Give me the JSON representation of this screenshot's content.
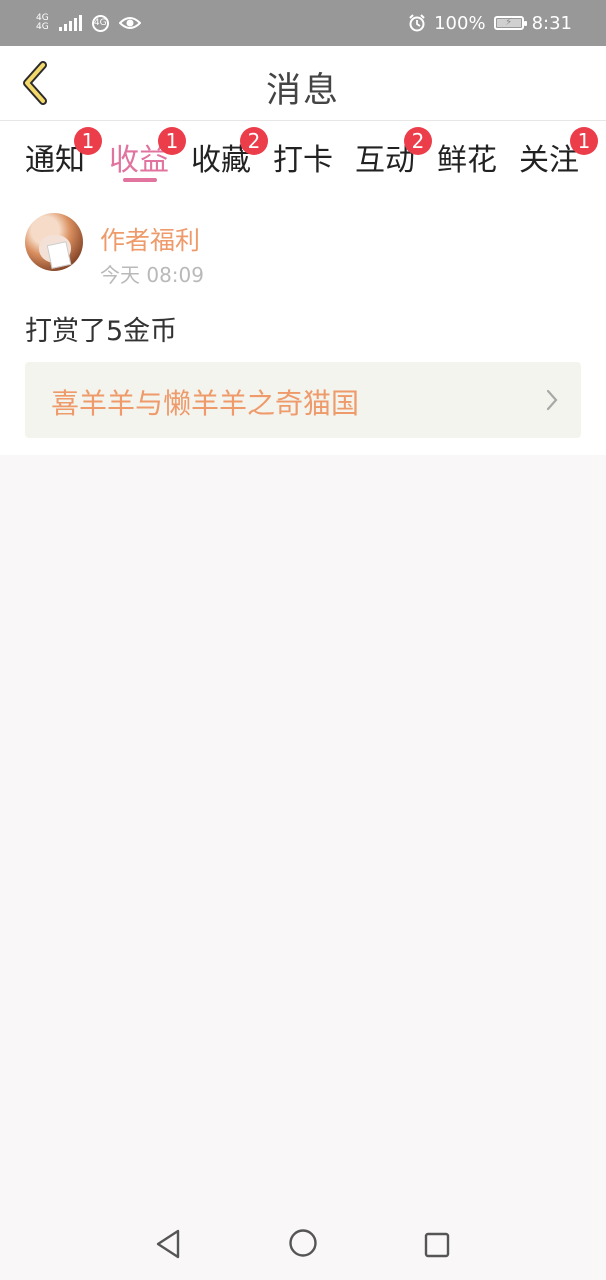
{
  "status_bar": {
    "network": [
      "4G",
      "4G"
    ],
    "circle_icon_text": "4G",
    "battery_percent": "100%",
    "time": "8:31"
  },
  "header": {
    "title": "消息"
  },
  "tabs": [
    {
      "label": "通知",
      "badge": "1",
      "active": false
    },
    {
      "label": "收益",
      "badge": "1",
      "active": true
    },
    {
      "label": "收藏",
      "badge": "2",
      "active": false
    },
    {
      "label": "打卡",
      "badge": "",
      "active": false
    },
    {
      "label": "互动",
      "badge": "2",
      "active": false
    },
    {
      "label": "鲜花",
      "badge": "",
      "active": false
    },
    {
      "label": "关注",
      "badge": "1",
      "active": false
    }
  ],
  "message_card": {
    "sender": "作者福利",
    "time": "今天 08:09",
    "text": "打赏了5金币",
    "book_title": "喜羊羊与懒羊羊之奇猫国"
  },
  "colors": {
    "accent": "#e0749f",
    "orange_text": "#ee9a6a",
    "badge": "#ec3d4a",
    "status_bar": "#989898"
  },
  "icons": {
    "back": "chevron-left-icon",
    "book_link": "chevron-right-icon",
    "nav_back": "triangle-back-icon",
    "nav_home": "circle-home-icon",
    "nav_recent": "square-recent-icon",
    "alarm": "alarm-icon",
    "eye": "eye-icon",
    "signal": "signal-icon"
  }
}
